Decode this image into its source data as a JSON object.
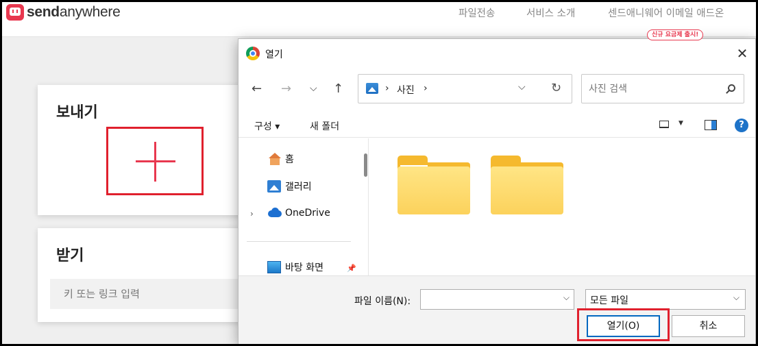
{
  "site": {
    "logo_bold": "send",
    "logo_rest": "anywhere",
    "nav": [
      "파일전송",
      "서비스 소개",
      "센드애니웨어 이메일 애드온"
    ],
    "promo_badge": "신규 요금제 출시!"
  },
  "send_card": {
    "title": "보내기"
  },
  "receive_card": {
    "title": "받기",
    "input_placeholder": "키 또는 링크 입력"
  },
  "dialog": {
    "title": "열기",
    "close_glyph": "✕",
    "nav_buttons": {
      "back": "←",
      "forward": "→",
      "recent": "⌵",
      "up": "↑"
    },
    "address": {
      "separator": "›",
      "location": "사진",
      "trailing_separator": "›"
    },
    "search_placeholder": "사진 검색",
    "commands": {
      "organize": "구성 ▾",
      "new_folder": "새 폴더"
    },
    "help_glyph": "?",
    "tree": [
      {
        "label": "홈",
        "icon": "home-icon"
      },
      {
        "label": "갤러리",
        "icon": "gallery-icon"
      },
      {
        "label": "OneDrive",
        "icon": "onedrive-cloud-icon"
      },
      {
        "label": "바탕 화면",
        "icon": "desktop-icon"
      }
    ],
    "folders_count_note": "",
    "file_name_label": "파일 이름(N):",
    "file_name_value": "",
    "file_type": "모든 파일",
    "open_button": "열기(O)",
    "cancel_button": "취소"
  },
  "colors": {
    "brand": "#e8384f",
    "highlight": "#e0202d",
    "accent": "#0067c0"
  }
}
